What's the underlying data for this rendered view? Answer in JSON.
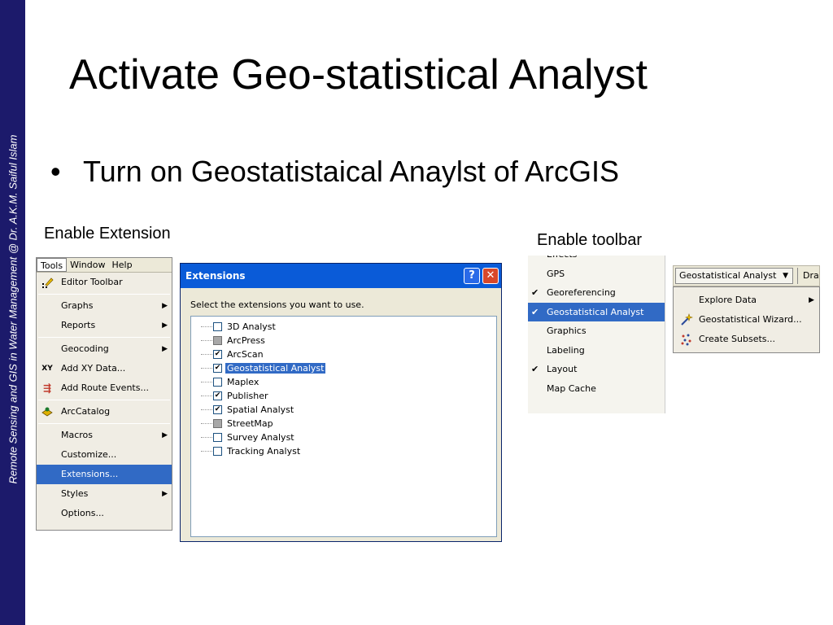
{
  "sidebar_text": "Remote Sensing and GIS in Water Management  @ Dr. A.K.M. Saiful Islam",
  "slide_title": "Activate Geo-statistical Analyst",
  "bullet": "Turn on Geostatistaical Anaylst of ArcGIS",
  "captions": {
    "left": "Enable Extension",
    "right": "Enable toolbar"
  },
  "tools_menu": {
    "menubar": [
      "Tools",
      "Window",
      "Help"
    ],
    "items": {
      "editor_toolbar": "Editor Toolbar",
      "graphs": "Graphs",
      "reports": "Reports",
      "geocoding": "Geocoding",
      "add_xy": "Add XY Data...",
      "add_route": "Add Route Events...",
      "arccatalog": "ArcCatalog",
      "macros": "Macros",
      "customize": "Customize...",
      "extensions": "Extensions...",
      "styles": "Styles",
      "options": "Options..."
    }
  },
  "extensions_dialog": {
    "title": "Extensions",
    "help_glyph": "?",
    "close_glyph": "✕",
    "prompt": "Select the extensions you want to use.",
    "items": [
      {
        "label": "3D Analyst",
        "state": "unchecked"
      },
      {
        "label": "ArcPress",
        "state": "gray"
      },
      {
        "label": "ArcScan",
        "state": "checked"
      },
      {
        "label": "Geostatistical Analyst",
        "state": "checked",
        "selected": true
      },
      {
        "label": "Maplex",
        "state": "unchecked"
      },
      {
        "label": "Publisher",
        "state": "checked"
      },
      {
        "label": "Spatial Analyst",
        "state": "checked"
      },
      {
        "label": "StreetMap",
        "state": "gray"
      },
      {
        "label": "Survey Analyst",
        "state": "unchecked"
      },
      {
        "label": "Tracking Analyst",
        "state": "unchecked"
      }
    ]
  },
  "toolbars_list": {
    "check_glyph": "✔",
    "items": [
      {
        "label": "Effects",
        "checked": false
      },
      {
        "label": "GPS",
        "checked": false
      },
      {
        "label": "Georeferencing",
        "checked": true
      },
      {
        "label": "Geostatistical Analyst",
        "checked": true,
        "selected": true
      },
      {
        "label": "Graphics",
        "checked": false
      },
      {
        "label": "Labeling",
        "checked": false
      },
      {
        "label": "Layout",
        "checked": true
      },
      {
        "label": "Map Cache",
        "checked": false
      }
    ]
  },
  "geo_toolbar": {
    "dropdown_label": "Geostatistical Analyst",
    "next_label": "Dra",
    "menu": {
      "explore_data": "Explore Data",
      "wizard": "Geostatistical Wizard...",
      "create_subsets": "Create Subsets..."
    }
  },
  "colors": {
    "sideband": "#1c1a6b",
    "selection": "#316ac5",
    "titlebar": "#0a5bd8"
  }
}
